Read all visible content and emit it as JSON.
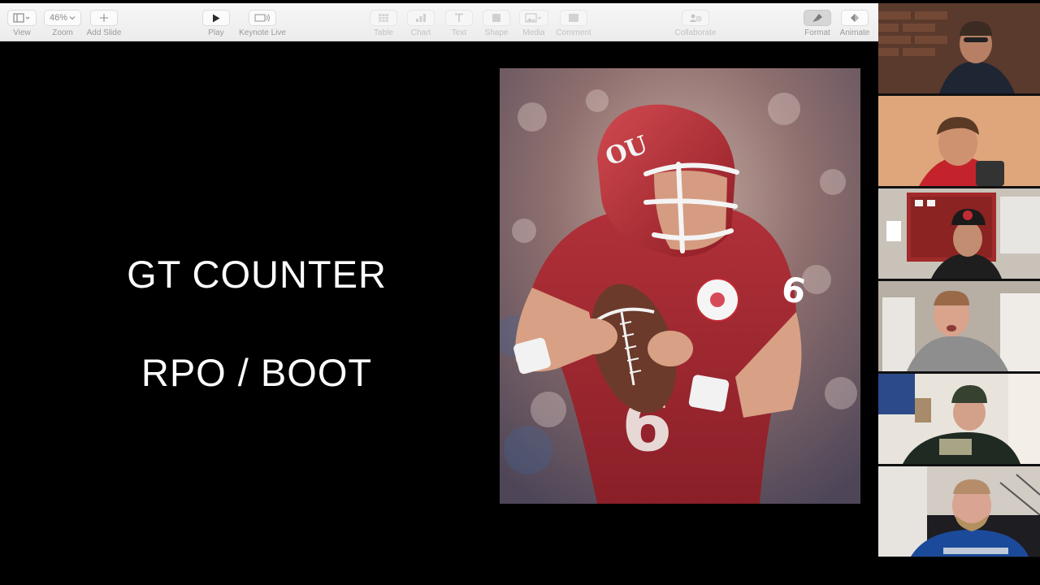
{
  "app": "Keynote",
  "toolbar": {
    "items": [
      {
        "label": "View",
        "icon": "sidebar-view-icon",
        "value": "",
        "enabled": true
      },
      {
        "label": "Zoom",
        "icon": "zoom-icon",
        "value": "46%",
        "enabled": true
      },
      {
        "label": "Add Slide",
        "icon": "plus-icon",
        "value": "",
        "enabled": true
      },
      {
        "label": "Play",
        "icon": "play-icon",
        "value": "",
        "enabled": true
      },
      {
        "label": "Keynote Live",
        "icon": "keynote-live-icon",
        "value": "",
        "enabled": true
      },
      {
        "label": "Table",
        "icon": "table-icon",
        "value": "",
        "enabled": false
      },
      {
        "label": "Chart",
        "icon": "chart-icon",
        "value": "",
        "enabled": false
      },
      {
        "label": "Text",
        "icon": "text-icon",
        "value": "",
        "enabled": false
      },
      {
        "label": "Shape",
        "icon": "shape-icon",
        "value": "",
        "enabled": false
      },
      {
        "label": "Media",
        "icon": "media-icon",
        "value": "",
        "enabled": false
      },
      {
        "label": "Comment",
        "icon": "comment-icon",
        "value": "",
        "enabled": false
      },
      {
        "label": "Collaborate",
        "icon": "collaborate-icon",
        "value": "",
        "enabled": false
      },
      {
        "label": "Format",
        "icon": "format-brush-icon",
        "value": "",
        "enabled": true
      },
      {
        "label": "Animate",
        "icon": "animate-diamond-icon",
        "value": "",
        "enabled": true
      }
    ]
  },
  "slide": {
    "line1": "GT COUNTER",
    "line2": "RPO / BOOT",
    "photo": {
      "subject": "football-quarterback-photo",
      "jersey_number": "6",
      "colors": {
        "jersey": "#a42a33",
        "helmet": "#b3252f",
        "wristband": "#f2f2f2"
      }
    }
  },
  "participants": {
    "count": 6,
    "tiles": [
      {
        "name": "participant-1",
        "background": "#5a3a2c"
      },
      {
        "name": "participant-2",
        "background": "#d89a6c"
      },
      {
        "name": "participant-3",
        "background": "#c9c2b8"
      },
      {
        "name": "participant-4",
        "background": "#b7aea4"
      },
      {
        "name": "participant-5",
        "background": "#e8e4dc"
      },
      {
        "name": "participant-6",
        "background": "#d2ccc4"
      }
    ]
  },
  "colors": {
    "toolbar_bg": "#ececec",
    "slide_bg": "#000000",
    "slide_text": "#ffffff"
  }
}
